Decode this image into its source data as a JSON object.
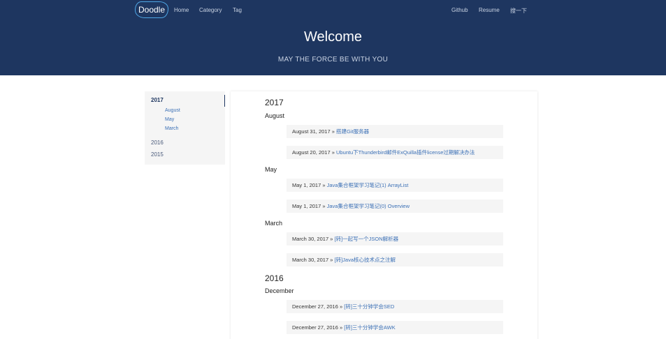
{
  "header": {
    "logo": "Doodle",
    "nav_left": [
      "Home",
      "Category",
      "Tag"
    ],
    "nav_right": [
      "Github",
      "Resume",
      "搜一下"
    ],
    "title": "Welcome",
    "subtitle": "MAY THE FORCE BE WITH YOU"
  },
  "sidebar": {
    "years": [
      {
        "label": "2017",
        "active": true,
        "months": [
          "August",
          "May",
          "March"
        ]
      },
      {
        "label": "2016",
        "active": false,
        "months": []
      },
      {
        "label": "2015",
        "active": false,
        "months": []
      }
    ]
  },
  "archive": {
    "separator": "»",
    "years": [
      {
        "year": "2017",
        "months": [
          {
            "month": "August",
            "posts": [
              {
                "date": "August 31, 2017",
                "title": "搭建Git服务器"
              },
              {
                "date": "August 20, 2017",
                "title": "Ubuntu下Thunderbird邮件ExQuilla插件license过期解决办法"
              }
            ]
          },
          {
            "month": "May",
            "posts": [
              {
                "date": "May 1, 2017",
                "title": "Java集合框架学习笔记(1) ArrayList"
              },
              {
                "date": "May 1, 2017",
                "title": "Java集合框架学习笔记(0) Overview"
              }
            ]
          },
          {
            "month": "March",
            "posts": [
              {
                "date": "March 30, 2017",
                "title": "[转]一起写一个JSON解析器"
              },
              {
                "date": "March 30, 2017",
                "title": "[转]Java核心技术点之注解"
              }
            ]
          }
        ]
      },
      {
        "year": "2016",
        "months": [
          {
            "month": "December",
            "posts": [
              {
                "date": "December 27, 2016",
                "title": "[转]三十分钟学会SED"
              },
              {
                "date": "December 27, 2016",
                "title": "[转]三十分钟学会AWK"
              }
            ]
          }
        ]
      }
    ]
  }
}
